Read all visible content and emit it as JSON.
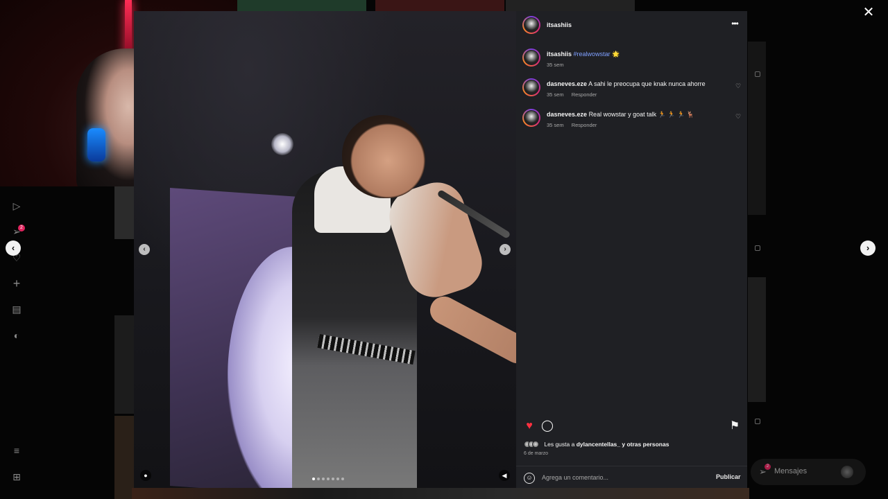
{
  "colors": {
    "like_red": "#ff3040",
    "tag_blue": "#7fa0ff",
    "panel_bg": "#1f2024",
    "overlay_bg": "#050505"
  },
  "post": {
    "username": "itsashiis",
    "media_dots": 7,
    "media_dot_active": 0
  },
  "caption": {
    "username": "itsashiis",
    "hashtag": "#realwowstar",
    "emoji": "🌟",
    "time": "35 sem"
  },
  "comments": [
    {
      "username": "dasneves.eze",
      "text": "A sahi le preocupa que knak nunca ahorre",
      "time": "35 sem",
      "reply_label": "Responder"
    },
    {
      "username": "dasneves.eze",
      "text": "Real wowstar y goat talk 🏃 🏃 🏃 🦌",
      "time": "35 sem",
      "reply_label": "Responder"
    }
  ],
  "likes": {
    "prefix": "Les gusta a",
    "user": "dylancentellas_",
    "suffix": "y otras personas",
    "liked": true
  },
  "date": "6 de marzo",
  "comment_box": {
    "placeholder": "Agrega un comentario...",
    "publish_label": "Publicar"
  },
  "messages": {
    "label": "Mensajes",
    "badge": "2"
  },
  "rail": {
    "notification_badge": "2"
  },
  "icons": {
    "close": "close-icon",
    "more": "more-options-icon",
    "prev": "chevron-left-icon",
    "next": "chevron-right-icon",
    "like": "heart-icon",
    "comment": "comment-icon",
    "save": "bookmark-icon",
    "emoji": "emoji-icon",
    "user_tag": "user-tag-icon",
    "mute": "speaker-icon"
  }
}
